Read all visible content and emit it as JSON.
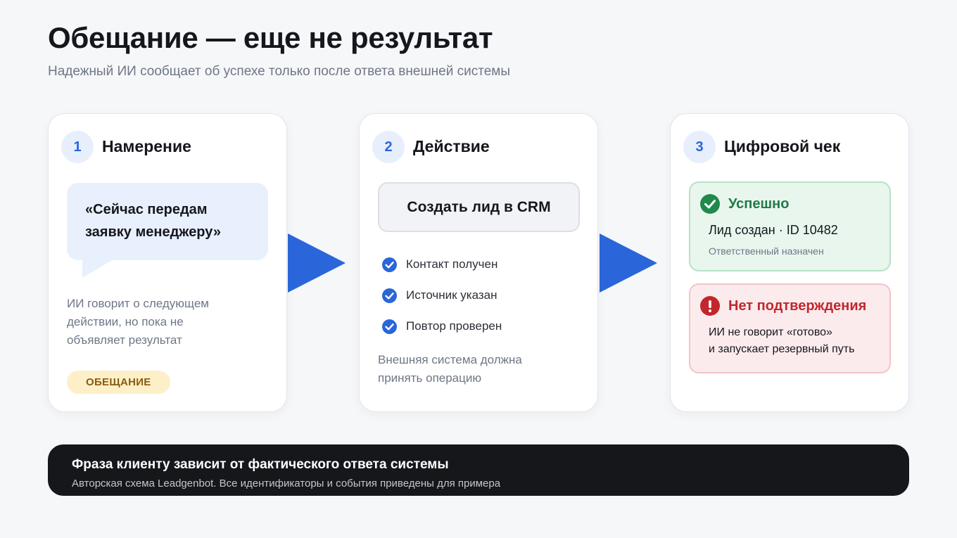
{
  "title": "Обещание — еще не результат",
  "subtitle": "Надежный ИИ сообщает об успехе только после ответа внешней системы",
  "colors": {
    "accent_blue": "#2a66d9",
    "arrow_blue": "#2a66d9",
    "success_green": "#1f7a46",
    "error_red": "#c1272d",
    "promise_pill": "#fdf0c8"
  },
  "steps": [
    {
      "number": "1",
      "title": "Намерение",
      "quote": "«Сейчас передам заявку менеджеру»",
      "note_lines": [
        "ИИ говорит о следующем",
        "действии, но пока не",
        "объявляет результат"
      ],
      "badge": "ОБЕЩАНИЕ"
    },
    {
      "number": "2",
      "title": "Действие",
      "action": "Создать лид в CRM",
      "checks": [
        "Контакт получен",
        "Источник указан",
        "Повтор проверен"
      ],
      "note_lines": [
        "Внешняя система должна",
        "принять операцию"
      ]
    },
    {
      "number": "3",
      "title": "Цифровой чек",
      "success": {
        "title": "Успешно",
        "line1": "Лид создан · ID 10482",
        "line2": "Ответственный назначен",
        "icon": "check-circle-icon"
      },
      "failure": {
        "title": "Нет подтверждения",
        "line1": "ИИ не говорит «готово»",
        "line2": "и запускает резервный путь",
        "icon": "exclamation-circle-icon"
      }
    }
  ],
  "footer": {
    "title": "Фраза клиенту зависит от фактического ответа системы",
    "note": "Авторская схема Leadgenbot. Все идентификаторы и события приведены для примера"
  }
}
